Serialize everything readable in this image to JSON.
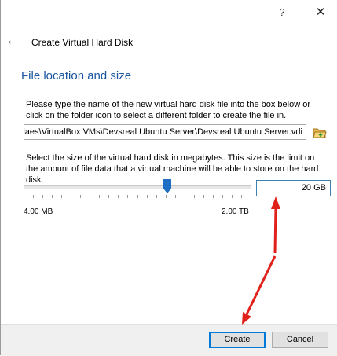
{
  "titlebar": {
    "help_label": "?",
    "close_label": "✕"
  },
  "wizard": {
    "back_icon": "←",
    "title": "Create Virtual Hard Disk"
  },
  "content": {
    "heading": "File location and size",
    "location_instructions": "Please type the name of the new virtual hard disk file into the box below or click on the folder icon to select a different folder to create the file in.",
    "file_path": "rlaes\\VirtualBox VMs\\Devsreal Ubuntu Server\\Devsreal Ubuntu Server.vdi",
    "size_instructions": "Select the size of the virtual hard disk in megabytes. This size is the limit on the amount of file data that a virtual machine will be able to store on the hard disk.",
    "size_value": "20 GB",
    "slider_position_fraction": 0.63,
    "min_label": "4.00 MB",
    "max_label": "2.00 TB"
  },
  "footer": {
    "create_label": "Create",
    "cancel_label": "Cancel"
  },
  "icons": {
    "folder": "folder-open-icon",
    "help": "help-icon",
    "close": "close-icon",
    "back": "back-arrow-icon"
  },
  "colors": {
    "heading": "#1a56a0",
    "slider_thumb": "#1e6fc4",
    "focus_border": "#0078d7",
    "annotation_arrow": "#e0201a"
  }
}
